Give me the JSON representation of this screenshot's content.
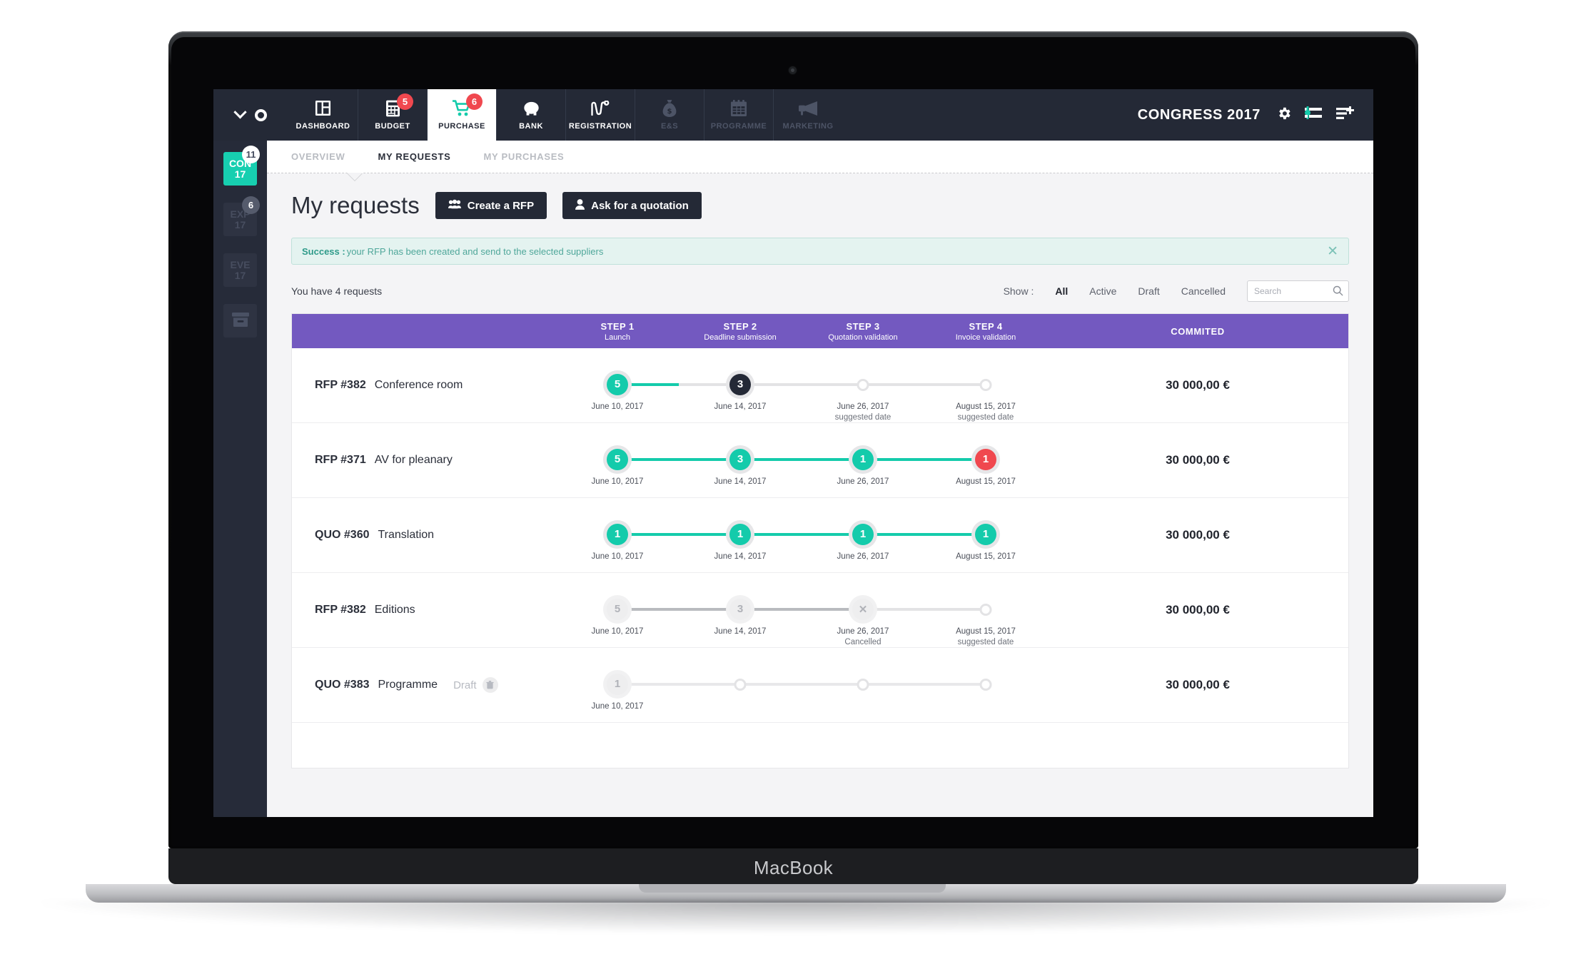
{
  "device": {
    "label": "MacBook"
  },
  "navbar": {
    "brand": {
      "chevron_icon": "chevron-down-icon",
      "ring_icon": "circle-outline-icon"
    },
    "items": [
      {
        "label": "DASHBOARD",
        "icon": "dashboard-icon",
        "badge": null,
        "state": "normal"
      },
      {
        "label": "BUDGET",
        "icon": "calculator-icon",
        "badge": "5",
        "state": "normal"
      },
      {
        "label": "PURCHASE",
        "icon": "cart-icon",
        "badge": "6",
        "state": "active"
      },
      {
        "label": "BANK",
        "icon": "piggy-bank-icon",
        "badge": null,
        "state": "normal"
      },
      {
        "label": "REGISTRATION",
        "icon": "line-chart-icon",
        "badge": null,
        "state": "normal"
      },
      {
        "label": "E&S",
        "icon": "money-bag-icon",
        "badge": null,
        "state": "disabled"
      },
      {
        "label": "PROGRAMME",
        "icon": "calendar-icon",
        "badge": null,
        "state": "disabled"
      },
      {
        "label": "MARKETING",
        "icon": "megaphone-icon",
        "badge": null,
        "state": "disabled"
      }
    ],
    "title": "CONGRESS 2017",
    "right_icons": [
      "gear-icon",
      "sliders-icon",
      "list-add-icon"
    ]
  },
  "sidebar": {
    "items": [
      {
        "line1": "CON",
        "line2": "17",
        "badge": "11",
        "badge_style": "light",
        "active": true
      },
      {
        "line1": "EXP",
        "line2": "17",
        "badge": "6",
        "badge_style": "grey",
        "active": false
      },
      {
        "line1": "EVE",
        "line2": "17",
        "badge": null,
        "badge_style": null,
        "active": false
      },
      {
        "line1": "",
        "line2": "",
        "icon": "archive-box-icon",
        "badge": null,
        "badge_style": null,
        "active": false
      }
    ]
  },
  "subnav": {
    "tabs": [
      {
        "label": "OVERVIEW",
        "active": false
      },
      {
        "label": "MY REQUESTS",
        "active": true
      },
      {
        "label": "MY PURCHASES",
        "active": false
      }
    ]
  },
  "page": {
    "title": "My requests",
    "buttons": [
      {
        "label": "Create a RFP",
        "icon": "users-icon"
      },
      {
        "label": "Ask for a quotation",
        "icon": "user-icon"
      }
    ]
  },
  "alert": {
    "strong": "Success :",
    "message": "your RFP has been created and send to the selected suppliers",
    "close_icon": "close-icon",
    "accent": "#2f9b8a",
    "bg": "#e4f3f0"
  },
  "filters": {
    "count_text": "You have 4 requests",
    "show_label": "Show :",
    "options": [
      {
        "label": "All",
        "active": true
      },
      {
        "label": "Active",
        "active": false
      },
      {
        "label": "Draft",
        "active": false
      },
      {
        "label": "Cancelled",
        "active": false
      }
    ],
    "search": {
      "value": "",
      "placeholder": "Search",
      "icon": "search-icon"
    }
  },
  "table": {
    "header_color": "#7359c0",
    "columns": [
      {
        "title": "STEP 1",
        "subtitle": "Launch"
      },
      {
        "title": "STEP 2",
        "subtitle": "Deadline submission"
      },
      {
        "title": "STEP 3",
        "subtitle": "Quotation validation"
      },
      {
        "title": "STEP 4",
        "subtitle": "Invoice validation"
      }
    ],
    "commited_label": "COMMITED",
    "rows": [
      {
        "ref": "RFP #382",
        "name": "Conference room",
        "draft": null,
        "amount": "30 000,00 €",
        "steps": [
          {
            "value": "5",
            "style": "teal",
            "date": "June 10, 2017",
            "note": ""
          },
          {
            "value": "3",
            "style": "dark",
            "date": "June 14, 2017",
            "note": ""
          },
          {
            "value": "",
            "style": "hollow",
            "date": "June 26, 2017",
            "note": "suggested date"
          },
          {
            "value": "",
            "style": "hollow",
            "date": "August 15, 2017",
            "note": "suggested date"
          }
        ],
        "connectors": [
          {
            "fill": 0.5,
            "color": "#14cbab"
          },
          {
            "fill": 0,
            "color": "#14cbab"
          },
          {
            "fill": 0,
            "color": "#14cbab"
          }
        ]
      },
      {
        "ref": "RFP #371",
        "name": "AV for pleanary",
        "draft": null,
        "amount": "30 000,00 €",
        "steps": [
          {
            "value": "5",
            "style": "teal",
            "date": "June 10, 2017",
            "note": ""
          },
          {
            "value": "3",
            "style": "teal",
            "date": "June 14, 2017",
            "note": ""
          },
          {
            "value": "1",
            "style": "teal",
            "date": "June 26, 2017",
            "note": ""
          },
          {
            "value": "1",
            "style": "red",
            "date": "August 15, 2017",
            "note": ""
          }
        ],
        "connectors": [
          {
            "fill": 1,
            "color": "#14cbab"
          },
          {
            "fill": 1,
            "color": "#14cbab"
          },
          {
            "fill": 1,
            "color": "#14cbab"
          }
        ]
      },
      {
        "ref": "QUO #360",
        "name": "Translation",
        "draft": null,
        "amount": "30 000,00 €",
        "steps": [
          {
            "value": "1",
            "style": "teal",
            "date": "June 10, 2017",
            "note": ""
          },
          {
            "value": "1",
            "style": "teal",
            "date": "June 14, 2017",
            "note": ""
          },
          {
            "value": "1",
            "style": "teal",
            "date": "June 26, 2017",
            "note": ""
          },
          {
            "value": "1",
            "style": "teal",
            "date": "August 15, 2017",
            "note": ""
          }
        ],
        "connectors": [
          {
            "fill": 1,
            "color": "#14cbab"
          },
          {
            "fill": 1,
            "color": "#14cbab"
          },
          {
            "fill": 1,
            "color": "#14cbab"
          }
        ]
      },
      {
        "ref": "RFP #382",
        "name": "Editions",
        "draft": null,
        "amount": "30 000,00 €",
        "steps": [
          {
            "value": "5",
            "style": "grey",
            "date": "June 10, 2017",
            "note": ""
          },
          {
            "value": "3",
            "style": "grey",
            "date": "June 14, 2017",
            "note": ""
          },
          {
            "value": "✕",
            "style": "grey",
            "date": "June 26, 2017",
            "note": "Cancelled"
          },
          {
            "value": "",
            "style": "hollow",
            "date": "August 15, 2017",
            "note": "suggested date"
          }
        ],
        "connectors": [
          {
            "fill": 1,
            "color": "#b9bbbf"
          },
          {
            "fill": 1,
            "color": "#b9bbbf"
          },
          {
            "fill": 0,
            "color": "#b9bbbf"
          }
        ]
      },
      {
        "ref": "QUO #383",
        "name": "Programme",
        "draft": {
          "label": "Draft",
          "icon": "trash-icon"
        },
        "amount": "30 000,00 €",
        "steps": [
          {
            "value": "1",
            "style": "grey",
            "date": "June 10, 2017",
            "note": ""
          },
          {
            "value": "",
            "style": "hollow",
            "date": "",
            "note": ""
          },
          {
            "value": "",
            "style": "hollow",
            "date": "",
            "note": ""
          },
          {
            "value": "",
            "style": "hollow",
            "date": "",
            "note": ""
          }
        ],
        "connectors": [
          {
            "fill": 0,
            "color": "#e3e3e5"
          },
          {
            "fill": 0,
            "color": "#e3e3e5"
          },
          {
            "fill": 0,
            "color": "#e3e3e5"
          }
        ]
      }
    ]
  },
  "colors": {
    "teal": "#14cbab",
    "purple": "#7359c0",
    "dark": "#242936",
    "red": "#f0484f",
    "sidebar": "#262b39"
  }
}
